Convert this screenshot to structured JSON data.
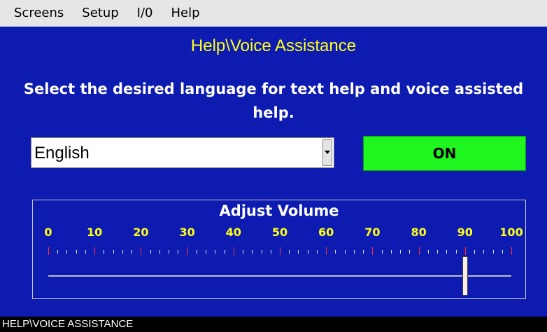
{
  "menu": {
    "items": [
      "Screens",
      "Setup",
      "I/0",
      "Help"
    ]
  },
  "screen": {
    "title": "Help\\Voice Assistance",
    "instruction_line1": "Select the desired language for text help and voice assisted",
    "instruction_line2": "help."
  },
  "language_select": {
    "value": "English"
  },
  "voice_toggle": {
    "label": "ON",
    "color": "#1ff51f"
  },
  "volume": {
    "title": "Adjust Volume",
    "scale_labels": [
      "0",
      "10",
      "20",
      "30",
      "40",
      "50",
      "60",
      "70",
      "80",
      "90",
      "100"
    ],
    "min": 0,
    "max": 100,
    "value": 90
  },
  "status_bar": {
    "text": "HELP\\VOICE ASSISTANCE"
  },
  "colors": {
    "background": "#0d1bb0",
    "title_text": "#ffff1a",
    "scale_labels": "#ffff1a",
    "major_tick": "#ff3030"
  }
}
